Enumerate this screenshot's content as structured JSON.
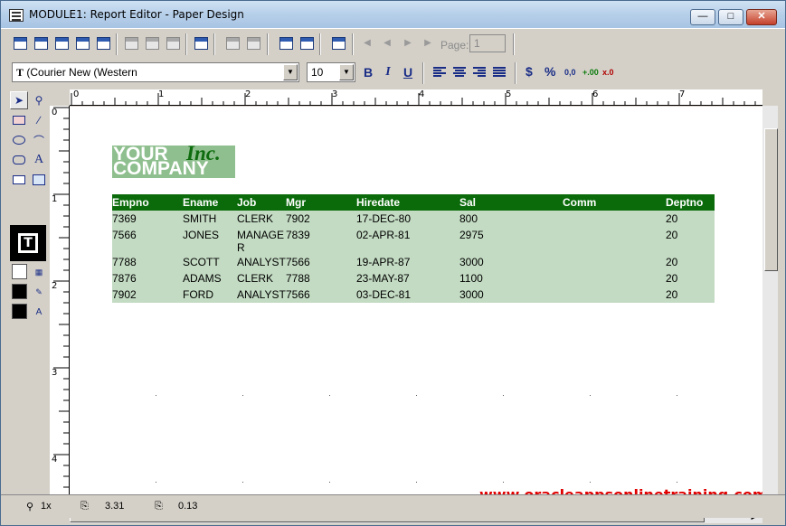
{
  "window": {
    "title": "MODULE1: Report Editor - Paper Design"
  },
  "toolbar": {
    "page_label": "Page:",
    "page_value": "1"
  },
  "format_bar": {
    "font": "(Courier New (Western",
    "size": "10",
    "bold": "B",
    "italic": "I",
    "underline": "U",
    "currency": "$",
    "percent": "%",
    "comma": "0,0",
    "add_decimal": "+.00",
    "remove_decimal": "x.0"
  },
  "rulers": {
    "horizontal": [
      "0",
      "1",
      "2",
      "3",
      "4",
      "5",
      "6",
      "7"
    ],
    "vertical": [
      "0",
      "1",
      "2",
      "3",
      "4"
    ]
  },
  "logo": {
    "line1": "YOUR",
    "inc": "Inc.",
    "line2": "COMPANY"
  },
  "report": {
    "columns": [
      "Empno",
      "Ename",
      "Job",
      "Mgr",
      "Hiredate",
      "Sal",
      "Comm",
      "Deptno"
    ],
    "rows": [
      [
        "7369",
        "SMITH",
        "CLERK",
        "7902",
        "17-DEC-80",
        "800",
        "",
        "20"
      ],
      [
        "7566",
        "JONES",
        "MANAGE\nR",
        "7839",
        "02-APR-81",
        "2975",
        "",
        "20"
      ],
      [
        "7788",
        "SCOTT",
        "ANALYST",
        "7566",
        "19-APR-87",
        "3000",
        "",
        "20"
      ],
      [
        "7876",
        "ADAMS",
        "CLERK",
        "7788",
        "23-MAY-87",
        "1100",
        "",
        "20"
      ],
      [
        "7902",
        "FORD",
        "ANALYST",
        "7566",
        "03-DEC-81",
        "3000",
        "",
        "20"
      ]
    ]
  },
  "watermark": "www.oracleappsonlinetraining.com",
  "status": {
    "zoom": "1x",
    "x_pos": "3.31",
    "y_pos": "0.13"
  },
  "colors": {
    "header_bg": "#0b6b0b",
    "body_bg": "#c3dbc3",
    "logo_bg": "#8fbf8f",
    "watermark": "#e00000"
  }
}
